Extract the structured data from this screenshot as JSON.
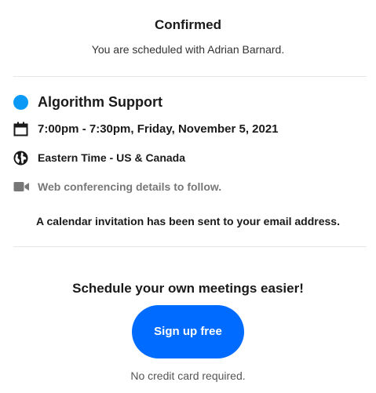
{
  "confirmation": {
    "title": "Confirmed",
    "subtitle": "You are scheduled with Adrian Barnard."
  },
  "event": {
    "name": "Algorithm Support",
    "color": "#0a9af5",
    "datetime": "7:00pm - 7:30pm, Friday, November 5, 2021",
    "timezone": "Eastern Time - US & Canada",
    "conferencing": "Web conferencing details to follow.",
    "icons": {
      "datetime": "calendar-icon",
      "timezone": "globe-icon",
      "conferencing": "video-camera-icon"
    }
  },
  "invitation_notice": "A calendar invitation has been sent to your email address.",
  "promo": {
    "heading": "Schedule your own meetings easier!",
    "button_label": "Sign up free",
    "button_color": "#006bff",
    "footnote": "No credit card required."
  }
}
